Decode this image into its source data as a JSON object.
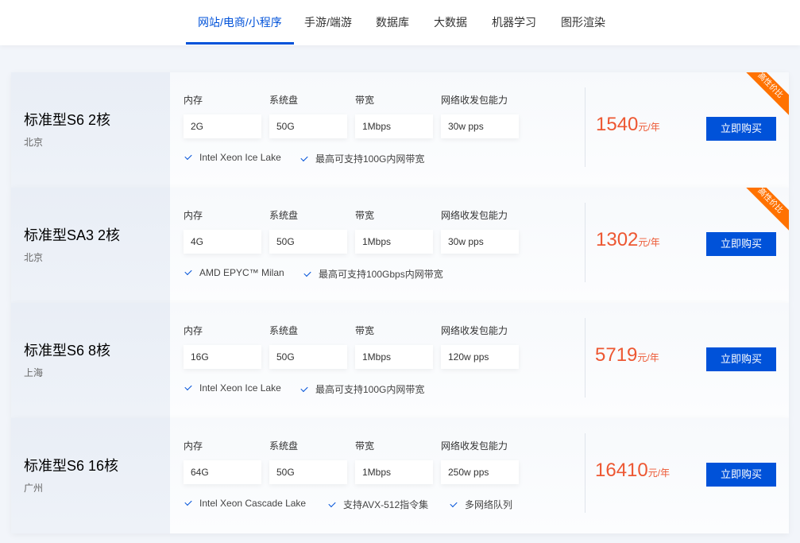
{
  "tabs": [
    {
      "label": "网站/电商/小程序",
      "active": true
    },
    {
      "label": "手游/端游",
      "active": false
    },
    {
      "label": "数据库",
      "active": false
    },
    {
      "label": "大数据",
      "active": false
    },
    {
      "label": "机器学习",
      "active": false
    },
    {
      "label": "图形渲染",
      "active": false
    }
  ],
  "spec_labels": {
    "memory": "内存",
    "disk": "系统盘",
    "bandwidth": "带宽",
    "pps": "网络收发包能力"
  },
  "buy_label": "立即购买",
  "price_unit": "元/年",
  "colors": {
    "accent": "#0052d9",
    "price": "#ed5732",
    "ribbon": "#ff7200"
  },
  "icons": {
    "feature": "checkmark-icon"
  },
  "products": [
    {
      "name": "标准型S6 2核",
      "region": "北京",
      "memory": "2G",
      "disk": "50G",
      "bandwidth": "1Mbps",
      "pps": "30w pps",
      "features": [
        "Intel Xeon Ice Lake",
        "最高可支持100G内网带宽"
      ],
      "price": "1540",
      "badge": "高性价比"
    },
    {
      "name": "标准型SA3 2核",
      "region": "北京",
      "memory": "4G",
      "disk": "50G",
      "bandwidth": "1Mbps",
      "pps": "30w pps",
      "features": [
        "AMD EPYC™ Milan",
        "最高可支持100Gbps内网带宽"
      ],
      "price": "1302",
      "badge": "高性价比"
    },
    {
      "name": "标准型S6 8核",
      "region": "上海",
      "memory": "16G",
      "disk": "50G",
      "bandwidth": "1Mbps",
      "pps": "120w pps",
      "features": [
        "Intel Xeon Ice Lake",
        "最高可支持100G内网带宽"
      ],
      "price": "5719",
      "badge": ""
    },
    {
      "name": "标准型S6 16核",
      "region": "广州",
      "memory": "64G",
      "disk": "50G",
      "bandwidth": "1Mbps",
      "pps": "250w pps",
      "features": [
        "Intel Xeon Cascade Lake",
        "支持AVX-512指令集",
        "多网络队列"
      ],
      "price": "16410",
      "badge": ""
    }
  ]
}
